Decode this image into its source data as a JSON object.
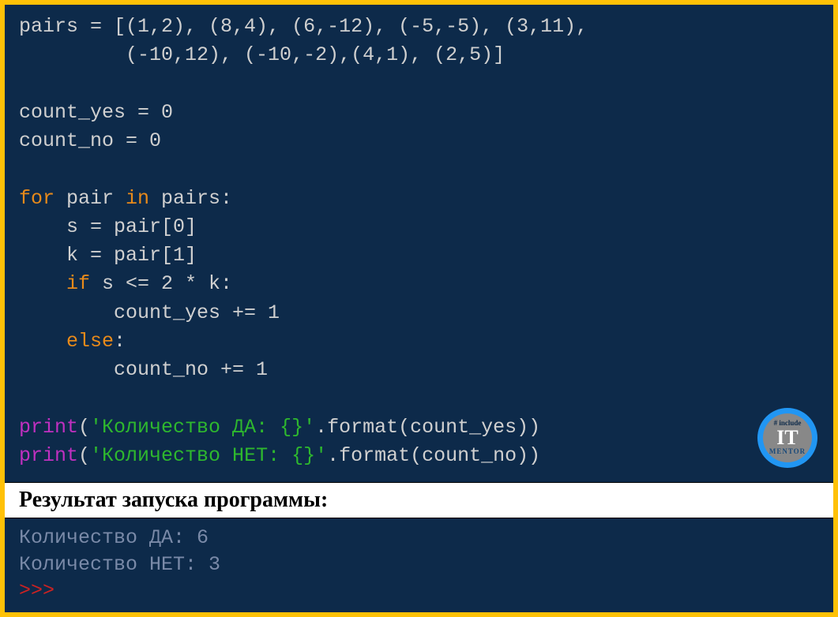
{
  "code": {
    "line1_pairs": "pairs",
    "line1_eq": " = [(",
    "line1_nums": "1,2), (8,4), (6,-12), (-5,-5), (3,11),",
    "line2_indent": "         (",
    "line2_nums": "-10,12), (-10,-2),(4,1), (2,5)]",
    "line4": "count_yes = 0",
    "line5": "count_no = 0",
    "line7_for": "for",
    "line7_pair": " pair ",
    "line7_in": "in",
    "line7_pairs": " pairs:",
    "line8": "    s = pair[0]",
    "line9": "    k = pair[1]",
    "line10_if": "    if",
    "line10_cond": " s <= 2 * k:",
    "line11": "        count_yes += 1",
    "line12_else": "    else",
    "line12_colon": ":",
    "line13": "        count_no += 1",
    "line15_print": "print",
    "line15_open": "(",
    "line15_str": "'Количество ДА: {}'",
    "line15_fmt": ".format(count_yes))",
    "line16_print": "print",
    "line16_open": "(",
    "line16_str": "'Количество НЕТ: {}'",
    "line16_fmt": ".format(count_no))"
  },
  "header": "Результат запуска программы:",
  "output": {
    "line1": "Количество ДА: 6",
    "line2": "Количество НЕТ: 3",
    "prompt": ">>>"
  },
  "logo": {
    "include": "# include",
    "it": "IT",
    "mentor": "MENTOR"
  }
}
